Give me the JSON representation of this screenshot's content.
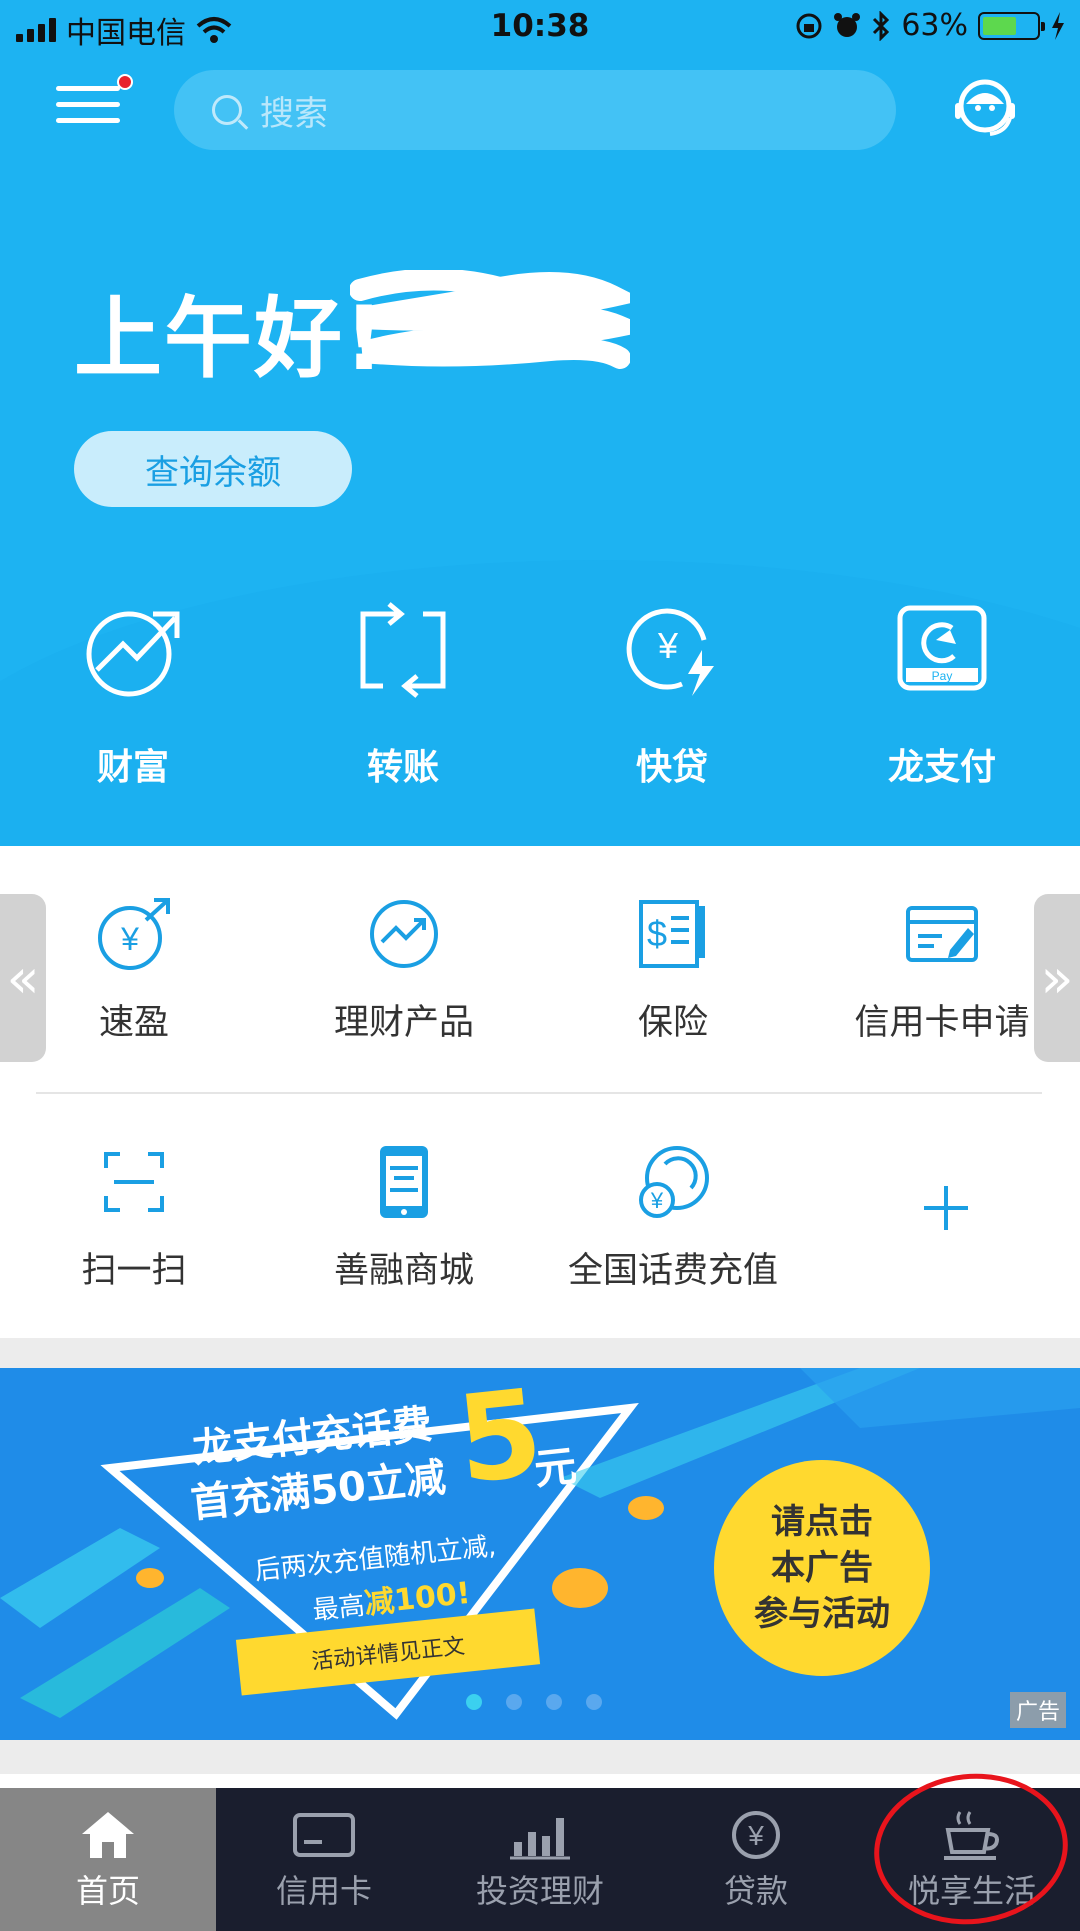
{
  "status_bar": {
    "carrier": "中国电信",
    "time": "10:38",
    "battery": "63%",
    "battery_level": 0.63
  },
  "header": {
    "search_placeholder": "搜索",
    "greeting": "上午好!",
    "balance_button": "查询余额"
  },
  "quick_actions": [
    {
      "label": "财富",
      "icon": "wealth-arrow-icon"
    },
    {
      "label": "转账",
      "icon": "transfer-icon"
    },
    {
      "label": "快贷",
      "icon": "quick-loan-icon"
    },
    {
      "label": "龙支付",
      "icon": "long-pay-icon"
    }
  ],
  "services_row1": [
    {
      "label": "速盈",
      "icon": "yuan-swap-icon"
    },
    {
      "label": "理财产品",
      "icon": "finance-product-icon"
    },
    {
      "label": "保险",
      "icon": "insurance-icon"
    },
    {
      "label": "信用卡申请",
      "icon": "credit-card-apply-icon"
    }
  ],
  "services_row2": [
    {
      "label": "扫一扫",
      "icon": "scan-icon"
    },
    {
      "label": "善融商城",
      "icon": "mall-phone-icon"
    },
    {
      "label": "全国话费充值",
      "icon": "phone-recharge-icon"
    },
    {
      "label": "",
      "icon": "plus-icon"
    }
  ],
  "banner": {
    "line1": "龙支付充话费",
    "line2": "首充满50立减",
    "big_number": "5",
    "unit": "元",
    "line3": "后两次充值随机立减,",
    "line4_prefix": "最高",
    "line4_highlight": "减100!",
    "ribbon": "活动详情见正文",
    "cta_line1": "请点击",
    "cta_line2": "本广告",
    "cta_line3": "参与活动",
    "ad_tag": "广告",
    "page_count": 4,
    "active_page": 1
  },
  "tabbar": [
    {
      "label": "首页",
      "icon": "home-icon",
      "active": true
    },
    {
      "label": "信用卡",
      "icon": "credit-card-icon",
      "active": false
    },
    {
      "label": "投资理财",
      "icon": "bar-chart-icon",
      "active": false
    },
    {
      "label": "贷款",
      "icon": "yuan-coin-icon",
      "active": false
    },
    {
      "label": "悦享生活",
      "icon": "coffee-cup-icon",
      "active": false
    }
  ],
  "colors": {
    "brand_blue": "#1db3f2",
    "tab_bar": "#1a1e2e",
    "accent_yellow": "#ffd92f",
    "annotation_red": "#e8141c"
  }
}
